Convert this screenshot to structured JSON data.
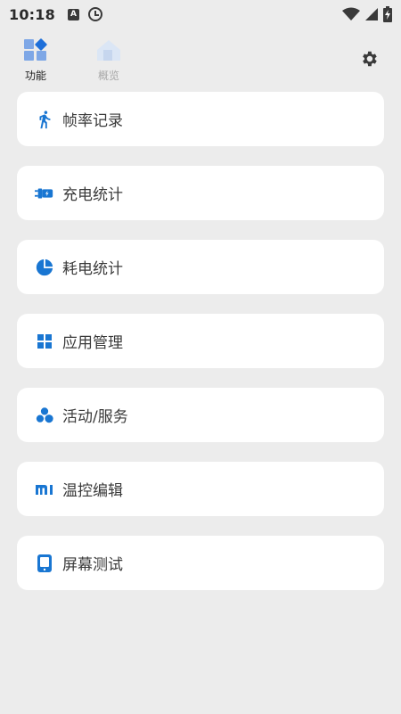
{
  "status_bar": {
    "time": "10:18",
    "notification_icons": [
      "font-a-icon",
      "clock-icon"
    ],
    "system_icons": [
      "wifi-icon",
      "cell-signal-icon",
      "battery-charging-icon"
    ]
  },
  "tabs": [
    {
      "label": "功能",
      "icon": "grid-diamond-icon",
      "active": true
    },
    {
      "label": "概览",
      "icon": "home-icon",
      "active": false
    }
  ],
  "header": {
    "settings_icon": "gear-icon"
  },
  "menu": [
    {
      "label": "帧率记录",
      "icon": "running-person-icon"
    },
    {
      "label": "充电统计",
      "icon": "charging-plug-icon"
    },
    {
      "label": "耗电统计",
      "icon": "pie-chart-icon"
    },
    {
      "label": "应用管理",
      "icon": "apps-grid-icon"
    },
    {
      "label": "活动/服务",
      "icon": "three-circles-icon"
    },
    {
      "label": "温控编辑",
      "icon": "mi-logo-icon"
    },
    {
      "label": "屏幕测试",
      "icon": "phone-screen-icon"
    }
  ],
  "colors": {
    "accent": "#1976d2",
    "background": "#ececec",
    "card": "#ffffff",
    "text": "#3a3a3a"
  }
}
